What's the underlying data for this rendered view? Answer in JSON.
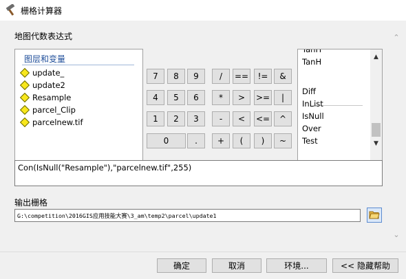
{
  "window": {
    "title": "栅格计算器"
  },
  "main": {
    "expression_section_label": "地图代数表达式",
    "layers": {
      "header": "图层和变量",
      "items": [
        "update_",
        "update2",
        "Resample",
        "parcel_Clip",
        "parcelnew.tif"
      ]
    },
    "calculator": {
      "row1": [
        "7",
        "8",
        "9",
        "/",
        "==",
        "!=",
        "&"
      ],
      "row2": [
        "4",
        "5",
        "6",
        "*",
        ">",
        ">=",
        "|"
      ],
      "row3": [
        "1",
        "2",
        "3",
        "-",
        "<",
        "<=",
        "^"
      ],
      "row4": [
        "0",
        ".",
        "+",
        "(",
        ")",
        "~"
      ]
    },
    "functions": {
      "items": [
        "TanH",
        "Diff",
        "InList",
        "IsNull",
        "Over",
        "Test"
      ]
    },
    "expression_value": "Con(IsNull(\"Resample\"),\"parcelnew.tif\",255)",
    "output_label": "输出栅格",
    "output_path": "G:\\competition\\2016GIS应用技能大赛\\3_am\\temp2\\parcel\\update1"
  },
  "footer": {
    "ok_label": "确定",
    "cancel_label": "取消",
    "env_label": "环境...",
    "help_label": "<< 隐藏帮助"
  },
  "icons": {
    "app": "hammer-icon",
    "browse": "folder-open-icon",
    "layer": "raster-layer-diamond-icon"
  },
  "colors": {
    "layer_diamond": "#f8e71c",
    "group_header": "#1f4e9a"
  }
}
